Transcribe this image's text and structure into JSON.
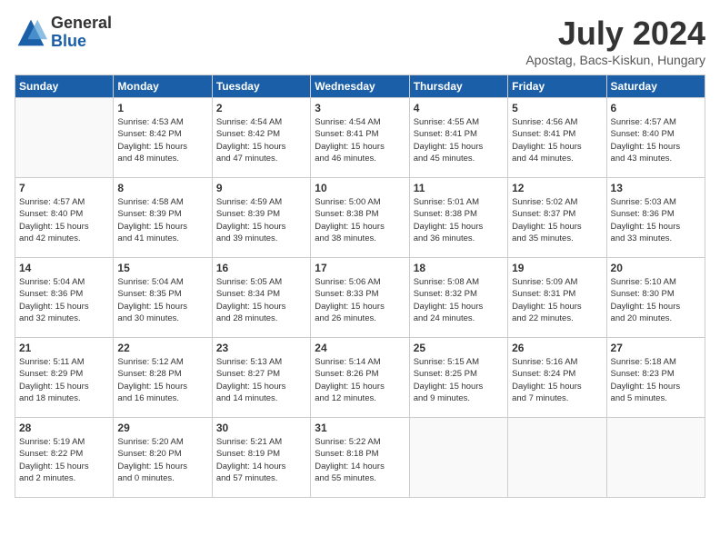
{
  "header": {
    "logo_general": "General",
    "logo_blue": "Blue",
    "title": "July 2024",
    "location": "Apostag, Bacs-Kiskun, Hungary"
  },
  "columns": [
    "Sunday",
    "Monday",
    "Tuesday",
    "Wednesday",
    "Thursday",
    "Friday",
    "Saturday"
  ],
  "weeks": [
    [
      {
        "day": "",
        "info": ""
      },
      {
        "day": "1",
        "info": "Sunrise: 4:53 AM\nSunset: 8:42 PM\nDaylight: 15 hours\nand 48 minutes."
      },
      {
        "day": "2",
        "info": "Sunrise: 4:54 AM\nSunset: 8:42 PM\nDaylight: 15 hours\nand 47 minutes."
      },
      {
        "day": "3",
        "info": "Sunrise: 4:54 AM\nSunset: 8:41 PM\nDaylight: 15 hours\nand 46 minutes."
      },
      {
        "day": "4",
        "info": "Sunrise: 4:55 AM\nSunset: 8:41 PM\nDaylight: 15 hours\nand 45 minutes."
      },
      {
        "day": "5",
        "info": "Sunrise: 4:56 AM\nSunset: 8:41 PM\nDaylight: 15 hours\nand 44 minutes."
      },
      {
        "day": "6",
        "info": "Sunrise: 4:57 AM\nSunset: 8:40 PM\nDaylight: 15 hours\nand 43 minutes."
      }
    ],
    [
      {
        "day": "7",
        "info": "Sunrise: 4:57 AM\nSunset: 8:40 PM\nDaylight: 15 hours\nand 42 minutes."
      },
      {
        "day": "8",
        "info": "Sunrise: 4:58 AM\nSunset: 8:39 PM\nDaylight: 15 hours\nand 41 minutes."
      },
      {
        "day": "9",
        "info": "Sunrise: 4:59 AM\nSunset: 8:39 PM\nDaylight: 15 hours\nand 39 minutes."
      },
      {
        "day": "10",
        "info": "Sunrise: 5:00 AM\nSunset: 8:38 PM\nDaylight: 15 hours\nand 38 minutes."
      },
      {
        "day": "11",
        "info": "Sunrise: 5:01 AM\nSunset: 8:38 PM\nDaylight: 15 hours\nand 36 minutes."
      },
      {
        "day": "12",
        "info": "Sunrise: 5:02 AM\nSunset: 8:37 PM\nDaylight: 15 hours\nand 35 minutes."
      },
      {
        "day": "13",
        "info": "Sunrise: 5:03 AM\nSunset: 8:36 PM\nDaylight: 15 hours\nand 33 minutes."
      }
    ],
    [
      {
        "day": "14",
        "info": "Sunrise: 5:04 AM\nSunset: 8:36 PM\nDaylight: 15 hours\nand 32 minutes."
      },
      {
        "day": "15",
        "info": "Sunrise: 5:04 AM\nSunset: 8:35 PM\nDaylight: 15 hours\nand 30 minutes."
      },
      {
        "day": "16",
        "info": "Sunrise: 5:05 AM\nSunset: 8:34 PM\nDaylight: 15 hours\nand 28 minutes."
      },
      {
        "day": "17",
        "info": "Sunrise: 5:06 AM\nSunset: 8:33 PM\nDaylight: 15 hours\nand 26 minutes."
      },
      {
        "day": "18",
        "info": "Sunrise: 5:08 AM\nSunset: 8:32 PM\nDaylight: 15 hours\nand 24 minutes."
      },
      {
        "day": "19",
        "info": "Sunrise: 5:09 AM\nSunset: 8:31 PM\nDaylight: 15 hours\nand 22 minutes."
      },
      {
        "day": "20",
        "info": "Sunrise: 5:10 AM\nSunset: 8:30 PM\nDaylight: 15 hours\nand 20 minutes."
      }
    ],
    [
      {
        "day": "21",
        "info": "Sunrise: 5:11 AM\nSunset: 8:29 PM\nDaylight: 15 hours\nand 18 minutes."
      },
      {
        "day": "22",
        "info": "Sunrise: 5:12 AM\nSunset: 8:28 PM\nDaylight: 15 hours\nand 16 minutes."
      },
      {
        "day": "23",
        "info": "Sunrise: 5:13 AM\nSunset: 8:27 PM\nDaylight: 15 hours\nand 14 minutes."
      },
      {
        "day": "24",
        "info": "Sunrise: 5:14 AM\nSunset: 8:26 PM\nDaylight: 15 hours\nand 12 minutes."
      },
      {
        "day": "25",
        "info": "Sunrise: 5:15 AM\nSunset: 8:25 PM\nDaylight: 15 hours\nand 9 minutes."
      },
      {
        "day": "26",
        "info": "Sunrise: 5:16 AM\nSunset: 8:24 PM\nDaylight: 15 hours\nand 7 minutes."
      },
      {
        "day": "27",
        "info": "Sunrise: 5:18 AM\nSunset: 8:23 PM\nDaylight: 15 hours\nand 5 minutes."
      }
    ],
    [
      {
        "day": "28",
        "info": "Sunrise: 5:19 AM\nSunset: 8:22 PM\nDaylight: 15 hours\nand 2 minutes."
      },
      {
        "day": "29",
        "info": "Sunrise: 5:20 AM\nSunset: 8:20 PM\nDaylight: 15 hours\nand 0 minutes."
      },
      {
        "day": "30",
        "info": "Sunrise: 5:21 AM\nSunset: 8:19 PM\nDaylight: 14 hours\nand 57 minutes."
      },
      {
        "day": "31",
        "info": "Sunrise: 5:22 AM\nSunset: 8:18 PM\nDaylight: 14 hours\nand 55 minutes."
      },
      {
        "day": "",
        "info": ""
      },
      {
        "day": "",
        "info": ""
      },
      {
        "day": "",
        "info": ""
      }
    ]
  ]
}
